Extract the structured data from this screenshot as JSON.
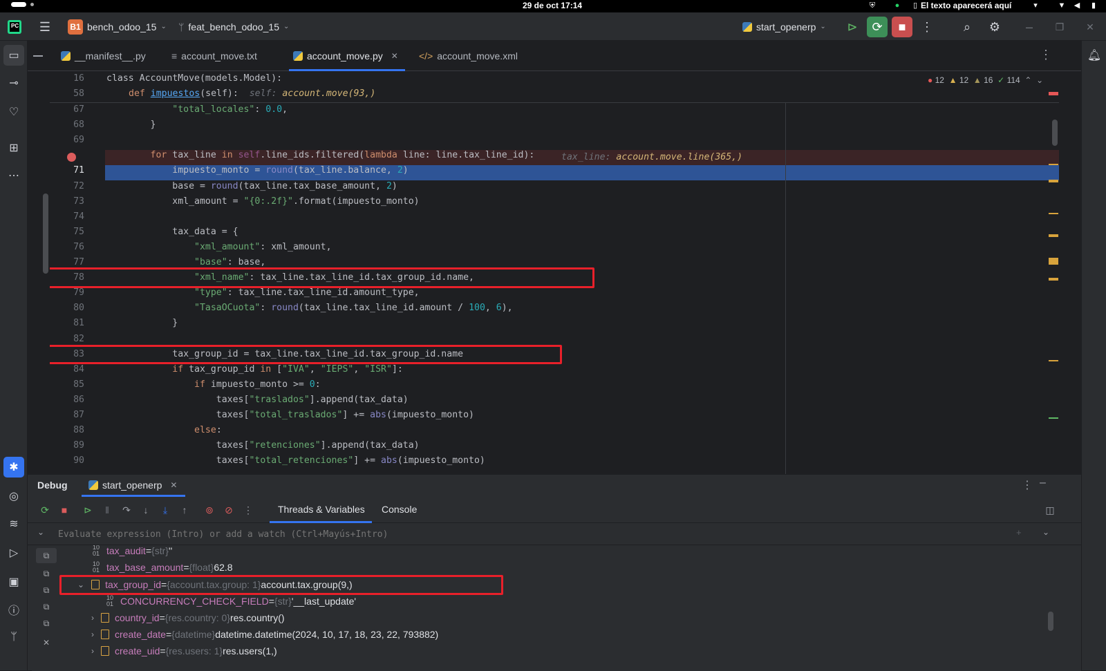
{
  "os": {
    "clock": "29 de oct  17:14",
    "notify_text": "El texto aparecerá aquí"
  },
  "titlebar": {
    "project_badge": "B1",
    "project": "bench_odoo_15",
    "branch": "feat_bench_odoo_15",
    "run_config": "start_openerp"
  },
  "tabs": [
    {
      "label": "__manifest__.py"
    },
    {
      "label": "account_move.txt"
    },
    {
      "label": "account_move.py"
    },
    {
      "label": "account_move.xml"
    }
  ],
  "inspections": {
    "errors": "12",
    "warnings": "12",
    "weak": "16",
    "ok": "114"
  },
  "sticky": {
    "l16_num": "16",
    "l58_num": "58",
    "l16_code": "class AccountMove(models.Model):",
    "l58_def": "def ",
    "l58_fn": "impuestos",
    "l58_args": "(self):",
    "l58_hint": "self: ",
    "l58_hintv": "account.move(93,)"
  },
  "lines": [
    {
      "n": "67",
      "t": "            \"total_locales\": 0.0,"
    },
    {
      "n": "68",
      "t": "        }"
    },
    {
      "n": "69",
      "t": ""
    },
    {
      "n": "70",
      "t": "        for tax_line in self.line_ids.filtered(lambda line: line.tax_line_id):"
    },
    {
      "n": "71",
      "t": "            impuesto_monto = round(tax_line.balance, 2)"
    },
    {
      "n": "72",
      "t": "            base = round(tax_line.tax_base_amount, 2)"
    },
    {
      "n": "73",
      "t": "            xml_amount = \"{0:.2f}\".format(impuesto_monto)"
    },
    {
      "n": "74",
      "t": ""
    },
    {
      "n": "75",
      "t": "            tax_data = {"
    },
    {
      "n": "76",
      "t": "                \"xml_amount\": xml_amount,"
    },
    {
      "n": "77",
      "t": "                \"base\": base,"
    },
    {
      "n": "78",
      "t": "                \"xml_name\": tax_line.tax_line_id.tax_group_id.name,"
    },
    {
      "n": "79",
      "t": "                \"type\": tax_line.tax_line_id.amount_type,"
    },
    {
      "n": "80",
      "t": "                \"TasaOCuota\": round(tax_line.tax_line_id.amount / 100, 6),"
    },
    {
      "n": "81",
      "t": "            }"
    },
    {
      "n": "82",
      "t": ""
    },
    {
      "n": "83",
      "t": "            tax_group_id = tax_line.tax_line_id.tax_group_id.name"
    },
    {
      "n": "84",
      "t": "            if tax_group_id in [\"IVA\", \"IEPS\", \"ISR\"]:"
    },
    {
      "n": "85",
      "t": "                if impuesto_monto >= 0:"
    },
    {
      "n": "86",
      "t": "                    taxes[\"traslados\"].append(tax_data)"
    },
    {
      "n": "87",
      "t": "                    taxes[\"total_traslados\"] += abs(impuesto_monto)"
    },
    {
      "n": "88",
      "t": "                else:"
    },
    {
      "n": "89",
      "t": "                    taxes[\"retenciones\"].append(tax_data)"
    },
    {
      "n": "90",
      "t": "                    taxes[\"total_retenciones\"] += abs(impuesto_monto)"
    }
  ],
  "inline_hint": {
    "label": "tax_line: ",
    "value": "account.move.line(365,)"
  },
  "debug": {
    "title": "Debug",
    "session": "start_openerp",
    "tab_threads": "Threads & Variables",
    "tab_console": "Console",
    "eval_placeholder": "Evaluate expression (Intro) or add a watch (Ctrl+Mayús+Intro)"
  },
  "variables": [
    {
      "name": "tax_audit",
      "eq": " = ",
      "type": "{str} ",
      "value": "''"
    },
    {
      "name": "tax_base_amount",
      "eq": " = ",
      "type": "{float} ",
      "value": "62.8"
    },
    {
      "name": "tax_group_id",
      "eq": " = ",
      "type": "{account.tax.group: 1} ",
      "value": "account.tax.group(9,)"
    },
    {
      "name": "CONCURRENCY_CHECK_FIELD",
      "eq": " = ",
      "type": "{str} ",
      "value": "'__last_update'"
    },
    {
      "name": "country_id",
      "eq": " = ",
      "type": "{res.country: 0} ",
      "value": "res.country()"
    },
    {
      "name": "create_date",
      "eq": " = ",
      "type": "{datetime} ",
      "value": "datetime.datetime(2024, 10, 17, 18, 23, 22, 793882)"
    },
    {
      "name": "create_uid",
      "eq": " = ",
      "type": "{res.users: 1} ",
      "value": "res.users(1,)"
    }
  ]
}
